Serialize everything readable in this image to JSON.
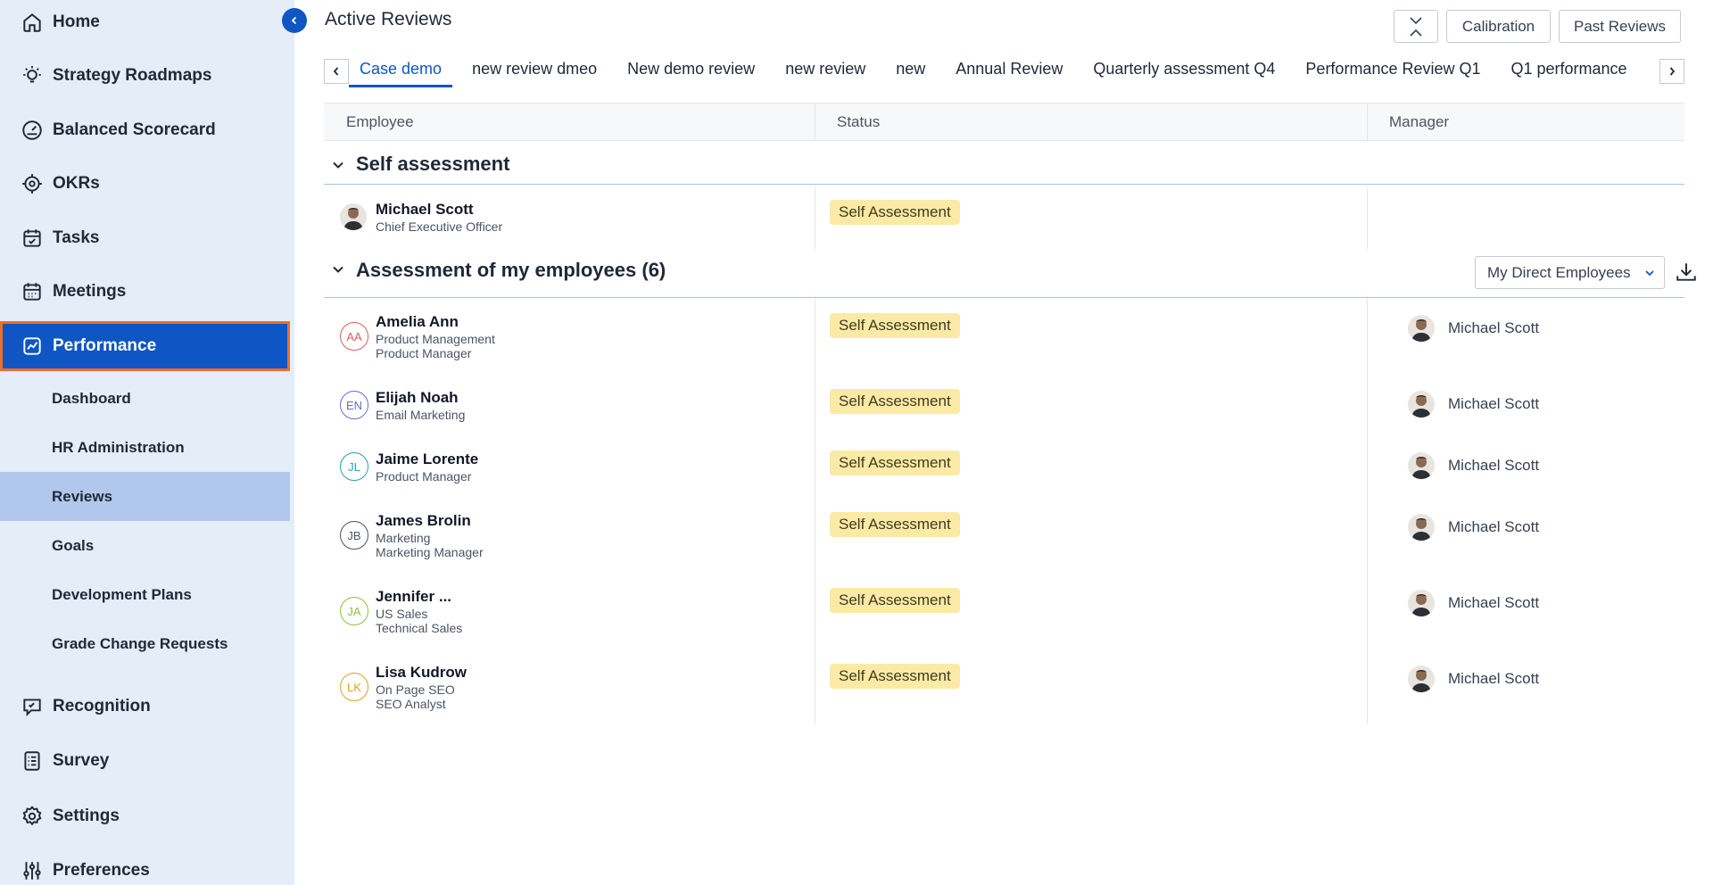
{
  "sidebar": {
    "items": [
      {
        "label": "Home",
        "icon": "home-icon"
      },
      {
        "label": "Strategy Roadmaps",
        "icon": "lightbulb-icon"
      },
      {
        "label": "Balanced Scorecard",
        "icon": "gauge-icon"
      },
      {
        "label": "OKRs",
        "icon": "target-icon"
      },
      {
        "label": "Tasks",
        "icon": "calendar-check-icon"
      },
      {
        "label": "Meetings",
        "icon": "calendar-icon"
      },
      {
        "label": "Performance",
        "icon": "chart-line-icon",
        "active": true
      }
    ],
    "sub_items": [
      {
        "label": "Dashboard"
      },
      {
        "label": "HR Administration"
      },
      {
        "label": "Reviews",
        "selected": true
      },
      {
        "label": "Goals"
      },
      {
        "label": "Development Plans"
      },
      {
        "label": "Grade Change Requests"
      }
    ],
    "bottom_items": [
      {
        "label": "Recognition",
        "icon": "chat-icon"
      },
      {
        "label": "Survey",
        "icon": "survey-icon"
      },
      {
        "label": "Settings",
        "icon": "gear-icon"
      },
      {
        "label": "Preferences",
        "icon": "sliders-icon"
      }
    ]
  },
  "header": {
    "title": "Active Reviews",
    "calibration_label": "Calibration",
    "past_reviews_label": "Past Reviews"
  },
  "tabs": [
    {
      "label": "Case demo",
      "active": true
    },
    {
      "label": "new review dmeo"
    },
    {
      "label": "New demo review"
    },
    {
      "label": "new review"
    },
    {
      "label": "new"
    },
    {
      "label": "Annual Review"
    },
    {
      "label": "Quarterly assessment Q4"
    },
    {
      "label": "Performance Review Q1"
    },
    {
      "label": "Q1 performance"
    }
  ],
  "columns": {
    "employee": "Employee",
    "status": "Status",
    "manager": "Manager"
  },
  "self_section": {
    "title": "Self assessment",
    "row": {
      "name": "Michael Scott",
      "lines": [
        "Chief Executive Officer"
      ],
      "status": "Self Assessment"
    }
  },
  "employees_section": {
    "title": "Assessment of my employees (6)",
    "filter_label": "My Direct Employees",
    "rows": [
      {
        "initials": "AA",
        "color": "#e05c5c",
        "name": "Amelia Ann",
        "lines": [
          "Product Management",
          "Product Manager"
        ],
        "status": "Self Assessment",
        "manager": "Michael Scott"
      },
      {
        "initials": "EN",
        "color": "#6b6fbf",
        "name": "Elijah Noah",
        "lines": [
          "Email Marketing"
        ],
        "status": "Self Assessment",
        "manager": "Michael Scott"
      },
      {
        "initials": "JL",
        "color": "#2a9fb0",
        "name": "Jaime Lorente",
        "lines": [
          "Product Manager"
        ],
        "status": "Self Assessment",
        "manager": "Michael Scott"
      },
      {
        "initials": "JB",
        "color": "#4a5568",
        "name": "James Brolin",
        "lines": [
          "Marketing",
          "Marketing Manager"
        ],
        "status": "Self Assessment",
        "manager": "Michael Scott"
      },
      {
        "initials": "JA",
        "color": "#8fbf3a",
        "name": "Jennifer ...",
        "lines": [
          "US Sales",
          "Technical Sales"
        ],
        "status": "Self Assessment",
        "manager": "Michael Scott"
      },
      {
        "initials": "LK",
        "color": "#e0a020",
        "name": "Lisa Kudrow",
        "lines": [
          "On Page SEO",
          "SEO Analyst"
        ],
        "status": "Self Assessment",
        "manager": "Michael Scott"
      }
    ]
  }
}
